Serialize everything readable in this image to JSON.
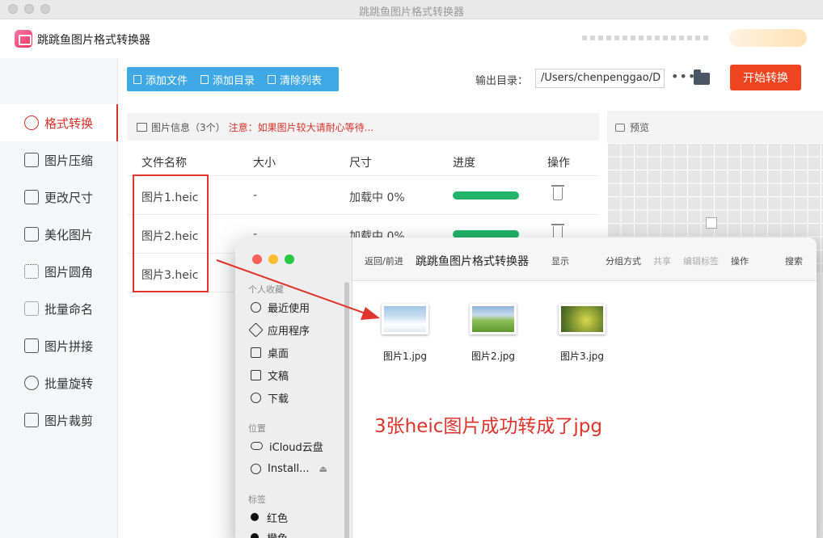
{
  "window": {
    "title": "跳跳鱼图片格式转换器"
  },
  "app": {
    "name": "跳跳鱼图片格式转换器"
  },
  "sidebar": {
    "items": [
      {
        "label": "格式转换",
        "icon": "convert-icon",
        "active": true
      },
      {
        "label": "图片压缩",
        "icon": "compress-icon"
      },
      {
        "label": "更改尺寸",
        "icon": "resize-icon"
      },
      {
        "label": "美化图片",
        "icon": "beautify-icon"
      },
      {
        "label": "图片圆角",
        "icon": "rounded-corner-icon"
      },
      {
        "label": "批量命名",
        "icon": "rename-icon"
      },
      {
        "label": "图片拼接",
        "icon": "stitch-icon"
      },
      {
        "label": "批量旋转",
        "icon": "rotate-icon"
      },
      {
        "label": "图片裁剪",
        "icon": "crop-icon"
      }
    ]
  },
  "toolbar": {
    "add_file": "添加文件",
    "add_dir": "添加目录",
    "clear_list": "清除列表",
    "output_label": "输出目录：",
    "output_path": "/Users/chenpenggao/D",
    "more": "•••",
    "start": "开始转换"
  },
  "info": {
    "title": "图片信息（3个）",
    "warning": "注意：如果图片较大请耐心等待..."
  },
  "table": {
    "headers": [
      "文件名称",
      "大小",
      "尺寸",
      "进度",
      "操作"
    ],
    "rows": [
      {
        "name": "图片1.heic",
        "size": "-",
        "dims": "加载中 0%",
        "progress": 1.0
      },
      {
        "name": "图片2.heic",
        "size": "-",
        "dims": "加载中 0%",
        "progress": 1.0
      },
      {
        "name": "图片3.heic",
        "size": "-",
        "dims": "",
        "progress": 1.0
      }
    ]
  },
  "preview": {
    "title": "预览"
  },
  "finder": {
    "nav": "返回/前进",
    "title": "跳跳鱼图片格式转换器",
    "toolbar": [
      "显示",
      "分组方式",
      "共享",
      "编辑标签",
      "操作",
      "搜索"
    ],
    "sections": {
      "favorites": "个人收藏",
      "locations": "位置",
      "tags": "标签"
    },
    "favorites": [
      "最近使用",
      "应用程序",
      "桌面",
      "文稿",
      "下载"
    ],
    "locations": [
      "iCloud云盘",
      "Install..."
    ],
    "tags": [
      "红色",
      "橙色"
    ],
    "files": [
      "图片1.jpg",
      "图片2.jpg",
      "图片3.jpg"
    ]
  },
  "annotation": "3张heic图片成功转成了jpg",
  "colors": {
    "accent": "#d6322a",
    "toolbar": "#3fa9e6",
    "start": "#f04420",
    "progress": "#22b46a"
  }
}
